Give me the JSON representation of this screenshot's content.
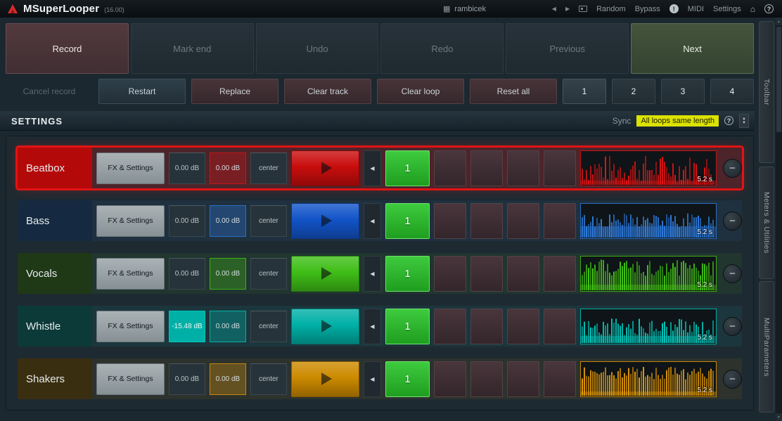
{
  "titlebar": {
    "title": "MSuperLooper",
    "version": "(16.00)",
    "preset": "rambicek",
    "prev_arrow": "◀",
    "next_arrow": "▶",
    "random_label": "Random",
    "bypass_label": "Bypass",
    "info_icon": "!",
    "midi_label": "MIDI",
    "settings_label": "Settings",
    "home_icon": "⌂",
    "help_icon": "?",
    "grid_icon": "▦"
  },
  "toolbar": {
    "record": "Record",
    "mark_end": "Mark end",
    "undo": "Undo",
    "redo": "Redo",
    "previous": "Previous",
    "next": "Next",
    "cancel_record": "Cancel record",
    "restart": "Restart",
    "replace": "Replace",
    "clear_track": "Clear track",
    "clear_loop": "Clear loop",
    "reset_all": "Reset all",
    "loop_1": "1",
    "loop_2": "2",
    "loop_3": "3",
    "loop_4": "4"
  },
  "settings": {
    "title": "SETTINGS",
    "sync_label": "Sync",
    "sync_value": "All loops same length",
    "sync_value_bg": "#dce202",
    "help_icon": "?"
  },
  "icons": {
    "rewind": "◀",
    "minus": "−",
    "spin_up": "▲",
    "spin_down": "▼"
  },
  "tracks": [
    {
      "name": "Beatbox",
      "fx_label": "FX & Settings",
      "gain1": "0.00 dB",
      "gain2": "0.00 dB",
      "pan": "center",
      "slot": "1",
      "length": "5.2 s",
      "selected": true,
      "colors": {
        "main": "#e01414",
        "name_bg": "#b40909",
        "play": "#c90d0d"
      }
    },
    {
      "name": "Bass",
      "fx_label": "FX & Settings",
      "gain1": "0.00 dB",
      "gain2": "0.00 dB",
      "pan": "center",
      "slot": "1",
      "length": "5.2 s",
      "selected": false,
      "colors": {
        "main": "#2f7de0",
        "name_bg": "#152a40",
        "play": "#1254c8"
      }
    },
    {
      "name": "Vocals",
      "fx_label": "FX & Settings",
      "gain1": "0.00 dB",
      "gain2": "0.00 dB",
      "pan": "center",
      "slot": "1",
      "length": "5.2 s",
      "selected": false,
      "colors": {
        "main": "#46c814",
        "name_bg": "#1f3816",
        "play": "#3fbe17"
      }
    },
    {
      "name": "Whistle",
      "fx_label": "FX & Settings",
      "gain1": "-15.48 dB",
      "gain1_filled": true,
      "gain2": "0.00 dB",
      "pan": "center",
      "slot": "1",
      "length": "5.2 s",
      "selected": false,
      "colors": {
        "main": "#00c8bc",
        "name_bg": "#0c3a38",
        "play": "#00b0a6"
      }
    },
    {
      "name": "Shakers",
      "fx_label": "FX & Settings",
      "gain1": "0.00 dB",
      "gain2": "0.00 dB",
      "pan": "center",
      "slot": "1",
      "length": "5.2 s",
      "selected": false,
      "colors": {
        "main": "#e69a06",
        "name_bg": "#3a2e10",
        "play": "#cc8a00"
      }
    }
  ],
  "sidebar": {
    "panels": [
      {
        "label": "Toolbar"
      },
      {
        "label": "Meters & Utilities"
      },
      {
        "label": "MultiParameters"
      }
    ]
  }
}
